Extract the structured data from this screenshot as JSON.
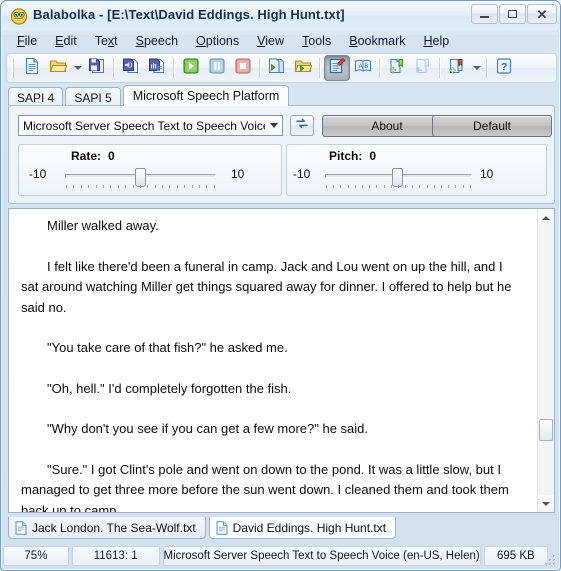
{
  "window": {
    "title": "Balabolka - [E:\\Text\\David Eddings. High Hunt.txt]",
    "app_icon": "smiley-face-icon",
    "minimize_label": "–",
    "maximize_label": "□",
    "close_label": "✕"
  },
  "menu": {
    "items": [
      {
        "label": "File",
        "accel": "F"
      },
      {
        "label": "Edit",
        "accel": "E"
      },
      {
        "label": "Text",
        "accel": "x"
      },
      {
        "label": "Speech",
        "accel": "S"
      },
      {
        "label": "Options",
        "accel": "O"
      },
      {
        "label": "View",
        "accel": "V"
      },
      {
        "label": "Tools",
        "accel": "T"
      },
      {
        "label": "Bookmark",
        "accel": "B"
      },
      {
        "label": "Help",
        "accel": "H"
      }
    ]
  },
  "toolbar": {
    "buttons": [
      {
        "name": "new-document-icon",
        "title": "New"
      },
      {
        "name": "open-folder-icon",
        "title": "Open"
      },
      {
        "name": "open-dropdown-arrow-icon",
        "title": "Open recent"
      },
      {
        "name": "save-icon",
        "title": "Save"
      },
      {
        "name": "read-aloud-icon",
        "title": "Read clipboard"
      },
      {
        "name": "save-audio-file-icon",
        "title": "Save audio file"
      },
      {
        "name": "play-icon",
        "title": "Play"
      },
      {
        "name": "pause-icon",
        "title": "Pause"
      },
      {
        "name": "stop-icon",
        "title": "Stop"
      },
      {
        "name": "convert-file-icon",
        "title": "Convert file"
      },
      {
        "name": "batch-convert-icon",
        "title": "Batch file conversion"
      },
      {
        "name": "edit-text-icon",
        "title": "Edit text",
        "pressed": true
      },
      {
        "name": "spell-check-icon",
        "title": "Spell check"
      },
      {
        "name": "add-bookmark-icon",
        "title": "Add bookmark"
      },
      {
        "name": "remove-bookmark-icon",
        "title": "Remove bookmark",
        "disabled": true
      },
      {
        "name": "bookmark-list-icon",
        "title": "Bookmarks"
      },
      {
        "name": "bookmark-dropdown-arrow-icon",
        "title": "Bookmark menu"
      },
      {
        "name": "help-icon",
        "title": "Help"
      }
    ]
  },
  "voice_tabs": {
    "items": [
      {
        "label": "SAPI 4",
        "active": false
      },
      {
        "label": "SAPI 5",
        "active": false
      },
      {
        "label": "Microsoft Speech Platform",
        "active": true
      }
    ]
  },
  "voice_panel": {
    "voice_combo": {
      "value": "Microsoft Server Speech Text to Speech Voice (e",
      "dropdown_icon": "chevron-down-icon"
    },
    "refresh_icon": "refresh-arrows-icon",
    "about_label": "About",
    "default_label": "Default",
    "rate": {
      "label": "Rate:",
      "value": "0",
      "min_label": "-10",
      "max_label": "10",
      "min": -10,
      "max": 10,
      "ticks": 21
    },
    "pitch": {
      "label": "Pitch:",
      "value": "0",
      "min_label": "-10",
      "max_label": "10",
      "min": -10,
      "max": 10,
      "ticks": 21
    }
  },
  "editor": {
    "paragraphs": [
      "Miller walked away.",
      "I felt like there'd been a funeral in camp. Jack and Lou went on up the hill, and I sat around watching Miller get things squared away for dinner. I offered to help but he said no.",
      "\"You take care of that fish?\" he asked me.",
      "\"Oh, hell.\" I'd completely forgotten the fish.",
      "\"Why don't you see if you can get a few more?\" he said.",
      "\"Sure.\" I got Clint's pole and went on down to the pond. It was a little slow, but I managed to get three more before the sun went down. I cleaned them and took them back up to camp."
    ],
    "scrollbar": {
      "up_icon": "triangle-up-icon",
      "down_icon": "triangle-down-icon"
    }
  },
  "document_tabs": {
    "items": [
      {
        "label": "Jack London. The Sea-Wolf.txt",
        "icon": "document-icon",
        "active": false
      },
      {
        "label": "David Eddings. High Hunt.txt",
        "icon": "document-icon",
        "active": true
      }
    ]
  },
  "statusbar": {
    "zoom": "75%",
    "position": "11613:  1",
    "voice": "Microsoft Server Speech Text to Speech Voice (en-US, Helen)",
    "filesize": "695 KB"
  },
  "colors": {
    "frame_border": "#6f9bc4",
    "title_text": "#16304d",
    "accent_blue": "#3f7fc1",
    "play_green": "#4ea832",
    "stop_red": "#d08a86",
    "folder_yellow": "#e8c558"
  }
}
